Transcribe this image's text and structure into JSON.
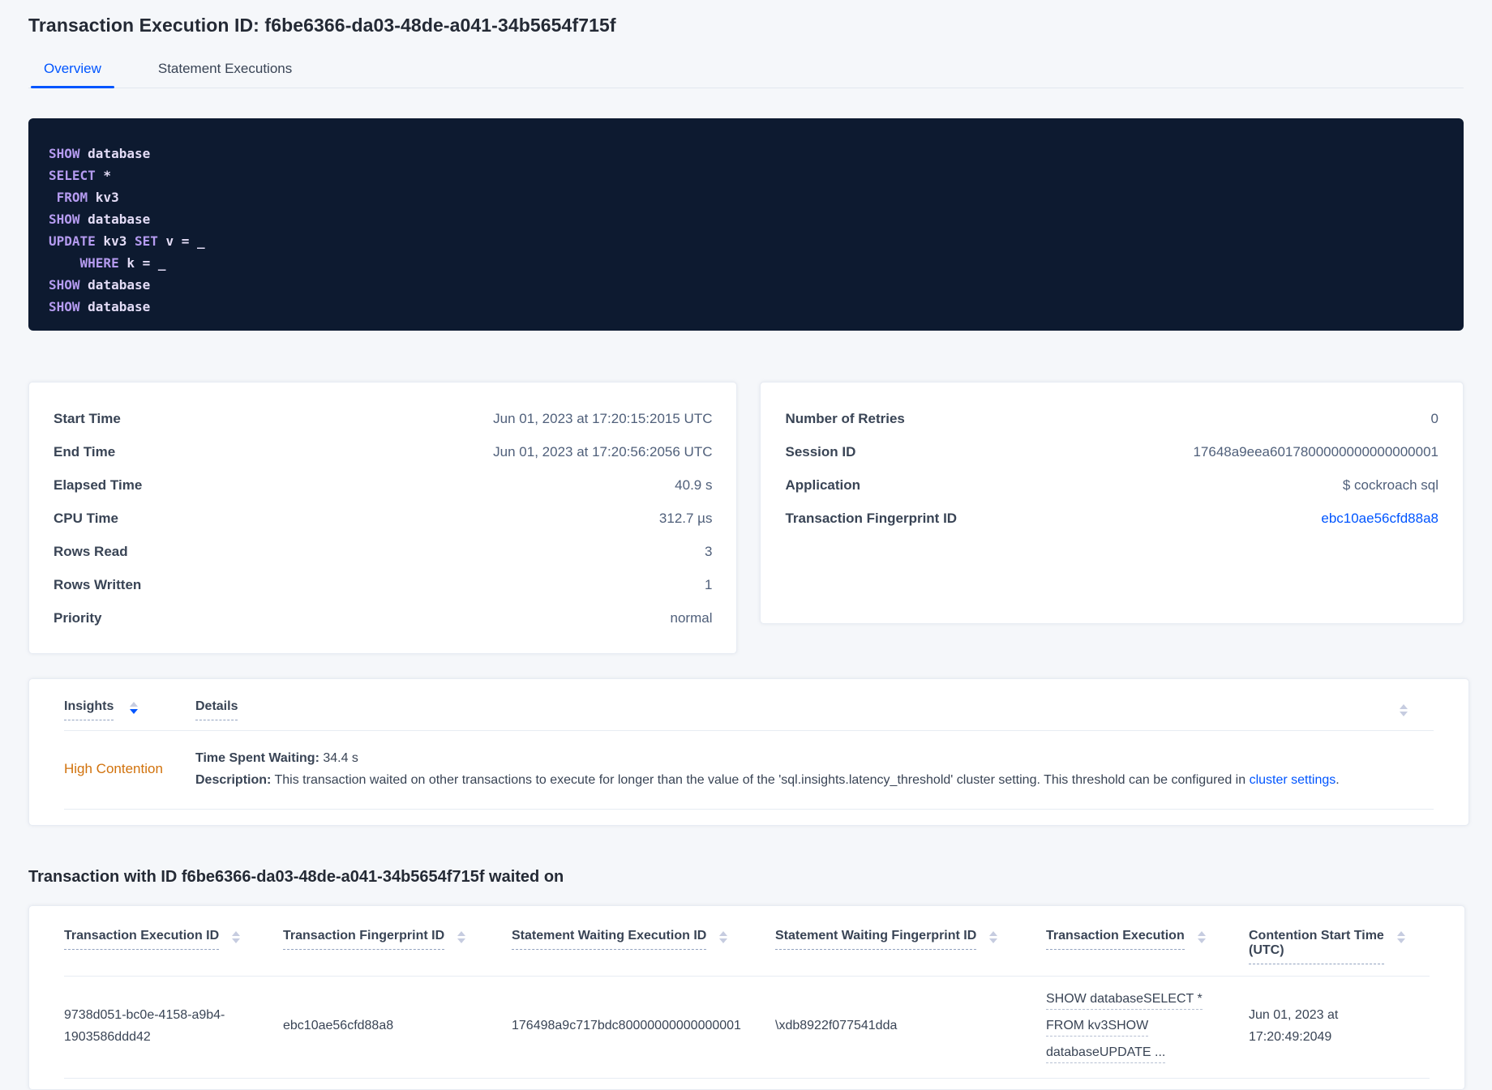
{
  "colors": {
    "accent_blue": "#0055ff",
    "warning_orange": "#d1720c",
    "code_background": "#0d1a30",
    "code_keyword": "#b59bf0",
    "code_text": "#e3dcf6",
    "page_background": "#f5f7fa"
  },
  "page": {
    "title": "Transaction Execution ID: f6be6366-da03-48de-a041-34b5654f715f"
  },
  "tabs": [
    {
      "label": "Overview"
    },
    {
      "label": "Statement Executions"
    }
  ],
  "sql_box": {
    "lines": [
      [
        {
          "c": "kw",
          "s": "SHOW"
        },
        {
          "c": "tx",
          "s": " database"
        }
      ],
      [
        {
          "c": "kw",
          "s": "SELECT"
        },
        {
          "c": "tx",
          "s": " *"
        }
      ],
      [
        {
          "c": "tx",
          "s": " "
        },
        {
          "c": "kw",
          "s": "FROM"
        },
        {
          "c": "tx",
          "s": " kv3"
        }
      ],
      [
        {
          "c": "kw",
          "s": "SHOW"
        },
        {
          "c": "tx",
          "s": " database"
        }
      ],
      [
        {
          "c": "kw",
          "s": "UPDATE"
        },
        {
          "c": "tx",
          "s": " kv3 "
        },
        {
          "c": "kw",
          "s": "SET"
        },
        {
          "c": "tx",
          "s": " v = _"
        }
      ],
      [
        {
          "c": "tx",
          "s": "    "
        },
        {
          "c": "kw",
          "s": "WHERE"
        },
        {
          "c": "tx",
          "s": " k = _"
        }
      ],
      [
        {
          "c": "kw",
          "s": "SHOW"
        },
        {
          "c": "tx",
          "s": " database"
        }
      ],
      [
        {
          "c": "kw",
          "s": "SHOW"
        },
        {
          "c": "tx",
          "s": " database"
        }
      ]
    ]
  },
  "details_card": {
    "rows": [
      {
        "label": "Start Time",
        "value": "Jun 01, 2023 at 17:20:15:2015 UTC"
      },
      {
        "label": "End Time",
        "value": "Jun 01, 2023 at 17:20:56:2056 UTC"
      },
      {
        "label": "Elapsed Time",
        "value": "40.9 s"
      },
      {
        "label": "CPU Time",
        "value": "312.7 µs"
      },
      {
        "label": "Rows Read",
        "value": "3"
      },
      {
        "label": "Rows Written",
        "value": "1"
      },
      {
        "label": "Priority",
        "value": "normal"
      }
    ]
  },
  "meta_card": {
    "rows": [
      {
        "label": "Number of Retries",
        "value": "0"
      },
      {
        "label": "Session ID",
        "value": "17648a9eea6017800000000000000001"
      },
      {
        "label": "Application",
        "value": "$ cockroach sql"
      }
    ],
    "fingerprint_label": "Transaction Fingerprint ID",
    "fingerprint_value": "ebc10ae56cfd88a8"
  },
  "insights": {
    "columns": {
      "insights": "Insights",
      "details": "Details"
    },
    "row": {
      "insight": "High Contention",
      "waiting_label": "Time Spent Waiting:",
      "waiting_value": " 34.4 s",
      "description_label": "Description:",
      "description_text": " This transaction waited on other transactions to execute for longer than the value of the 'sql.insights.latency_threshold' cluster setting. This threshold can be configured in ",
      "description_link": "cluster settings",
      "description_suffix": "."
    }
  },
  "waited_section": {
    "heading": "Transaction with ID f6be6366-da03-48de-a041-34b5654f715f waited on",
    "columns": [
      "Transaction Execution ID",
      "Transaction Fingerprint ID",
      "Statement Waiting Execution ID",
      "Statement Waiting Fingerprint ID",
      "Transaction Execution",
      "Contention Start Time (UTC)"
    ],
    "row": {
      "txn_execution_id": "9738d051-bc0e-4158-a9b4-1903586ddd42",
      "txn_fingerprint_id": "ebc10ae56cfd88a8",
      "stmt_waiting_execution_id": "176498a9c717bdc80000000000000001",
      "stmt_waiting_fingerprint_id": "\\xdb8922f077541dda",
      "txn_execution_lines": [
        "SHOW databaseSELECT *",
        "FROM kv3SHOW",
        "databaseUPDATE ..."
      ],
      "contention_start_time": "Jun 01, 2023 at 17:20:49:2049"
    }
  }
}
